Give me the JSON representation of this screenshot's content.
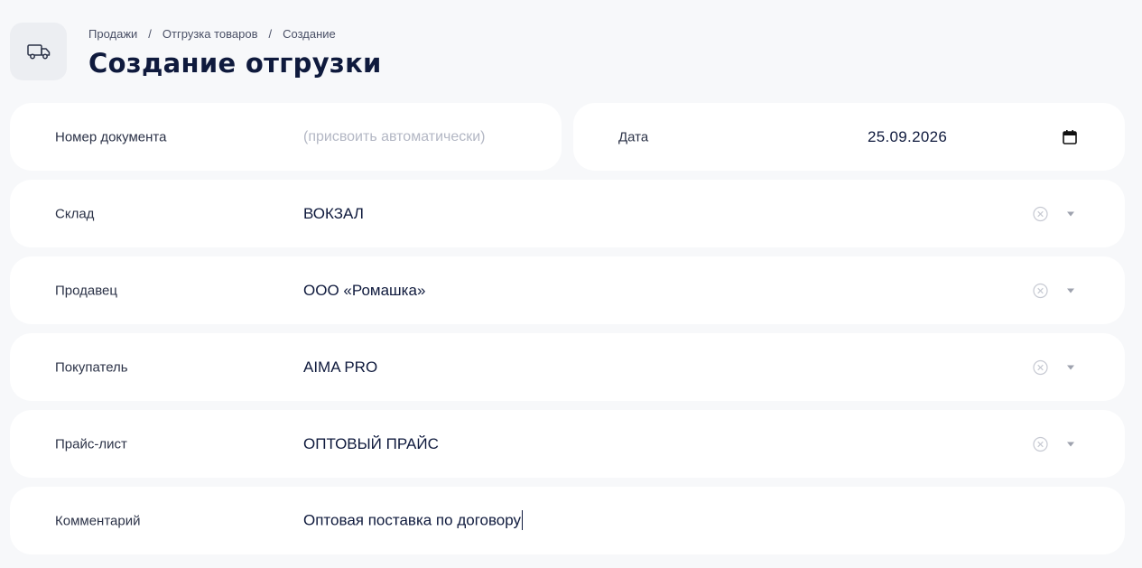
{
  "header": {
    "icon": "truck-icon",
    "breadcrumb": [
      "Продажи",
      "Отгрузка товаров",
      "Создание"
    ],
    "separator": "/",
    "title": "Создание отгрузки"
  },
  "form": {
    "document_number": {
      "label": "Номер документа",
      "placeholder": "(присвоить автоматически)"
    },
    "date": {
      "label": "Дата",
      "value": "25.09.2026"
    },
    "warehouse": {
      "label": "Склад",
      "value": "ВОКЗАЛ"
    },
    "seller": {
      "label": "Продавец",
      "value": "ООО «Ромашка»"
    },
    "buyer": {
      "label": "Покупатель",
      "value": "AIMA PRO"
    },
    "price_list": {
      "label": "Прайс-лист",
      "value": "ОПТОВЫЙ ПРАЙС"
    },
    "comment": {
      "label": "Комментарий",
      "value": "Оптовая поставка по договору"
    }
  },
  "colors": {
    "background": "#f7f8fa",
    "card": "#ffffff",
    "text": "#0f1a3d",
    "muted": "#b3b7c4"
  }
}
